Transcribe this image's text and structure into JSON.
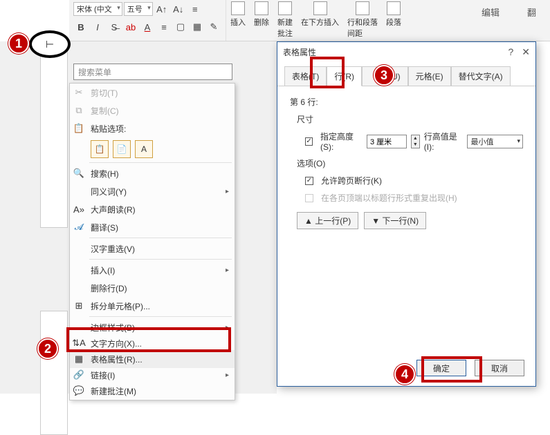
{
  "ribbon": {
    "font_name": "宋体 (中文",
    "font_size": "五号",
    "buttons": {
      "insert": "插入",
      "delete": "删除",
      "new_comment": "新建\n批注",
      "insert_below": "在下方插入",
      "row_col_spacing": "行和段落\n间距",
      "paragraph": "段落"
    },
    "tabs": {
      "edit": "编辑",
      "translate": "翻"
    }
  },
  "search": {
    "placeholder": "搜索菜单"
  },
  "ctx": {
    "cut": "剪切(T)",
    "copy": "复制(C)",
    "paste_header": "粘贴选项:",
    "search": "搜索(H)",
    "synonym": "同义词(Y)",
    "read_aloud": "大声朗读(R)",
    "translate": "翻译(S)",
    "hanzi": "汉字重选(V)",
    "insert": "插入(I)",
    "delete_row": "删除行(D)",
    "split_cell": "拆分单元格(P)...",
    "border_style": "边框样式(B)",
    "text_direction": "文字方向(X)...",
    "table_props": "表格属性(R)...",
    "link": "链接(I)",
    "new_comment": "新建批注(M)"
  },
  "dialog": {
    "title": "表格属性",
    "tabs": {
      "table": "表格(T)",
      "row": "行(R)",
      "column": "列(U)",
      "cell": "元格(E)",
      "alt_text": "替代文字(A)"
    },
    "row_info": "第 6 行:",
    "size_label": "尺寸",
    "specify_height": "指定高度(S):",
    "height_value": "3 厘米",
    "row_height_is": "行高值是(I):",
    "row_height_mode": "最小值",
    "options_label": "选项(O)",
    "allow_break": "允许跨页断行(K)",
    "repeat_header": "在各页顶端以标题行形式重复出现(H)",
    "prev_row": "▲ 上一行(P)",
    "next_row": "▼ 下一行(N)",
    "ok": "确定",
    "cancel": "取消"
  },
  "callouts": {
    "c1": "1",
    "c2": "2",
    "c3": "3",
    "c4": "4"
  }
}
